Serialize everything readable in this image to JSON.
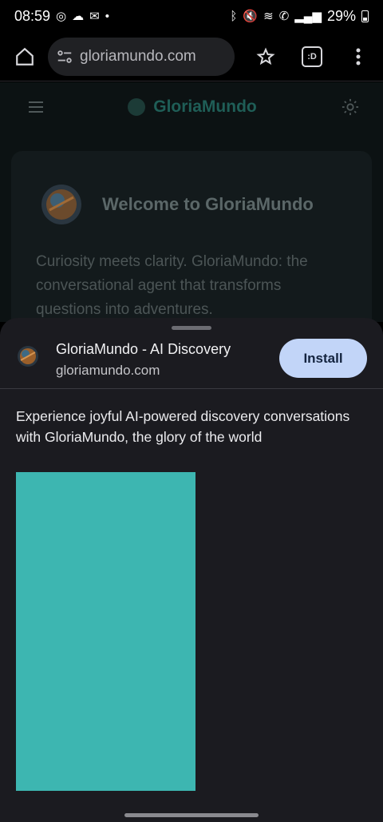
{
  "status_bar": {
    "time": "08:59",
    "battery": "29%",
    "icons": [
      "chrome-icon",
      "cloud-icon",
      "mail-icon",
      "dot-icon",
      "bluetooth-icon",
      "mute-icon",
      "wifi-icon",
      "call-icon",
      "signal-icon",
      "battery-icon"
    ]
  },
  "browser": {
    "url": "gloriamundo.com",
    "tab_count": ":D"
  },
  "site": {
    "brand": "GloriaMundo",
    "welcome_title": "Welcome to GloriaMundo",
    "description": "Curiosity meets clarity. GloriaMundo: the conversational agent that transforms questions into adventures."
  },
  "install_sheet": {
    "app_name": "GloriaMundo - AI Discovery",
    "app_domain": "gloriamundo.com",
    "install_label": "Install",
    "description": "Experience joyful AI-powered discovery conversations with GloriaMundo, the glory of the world",
    "preview_color": "#3db6b1"
  }
}
